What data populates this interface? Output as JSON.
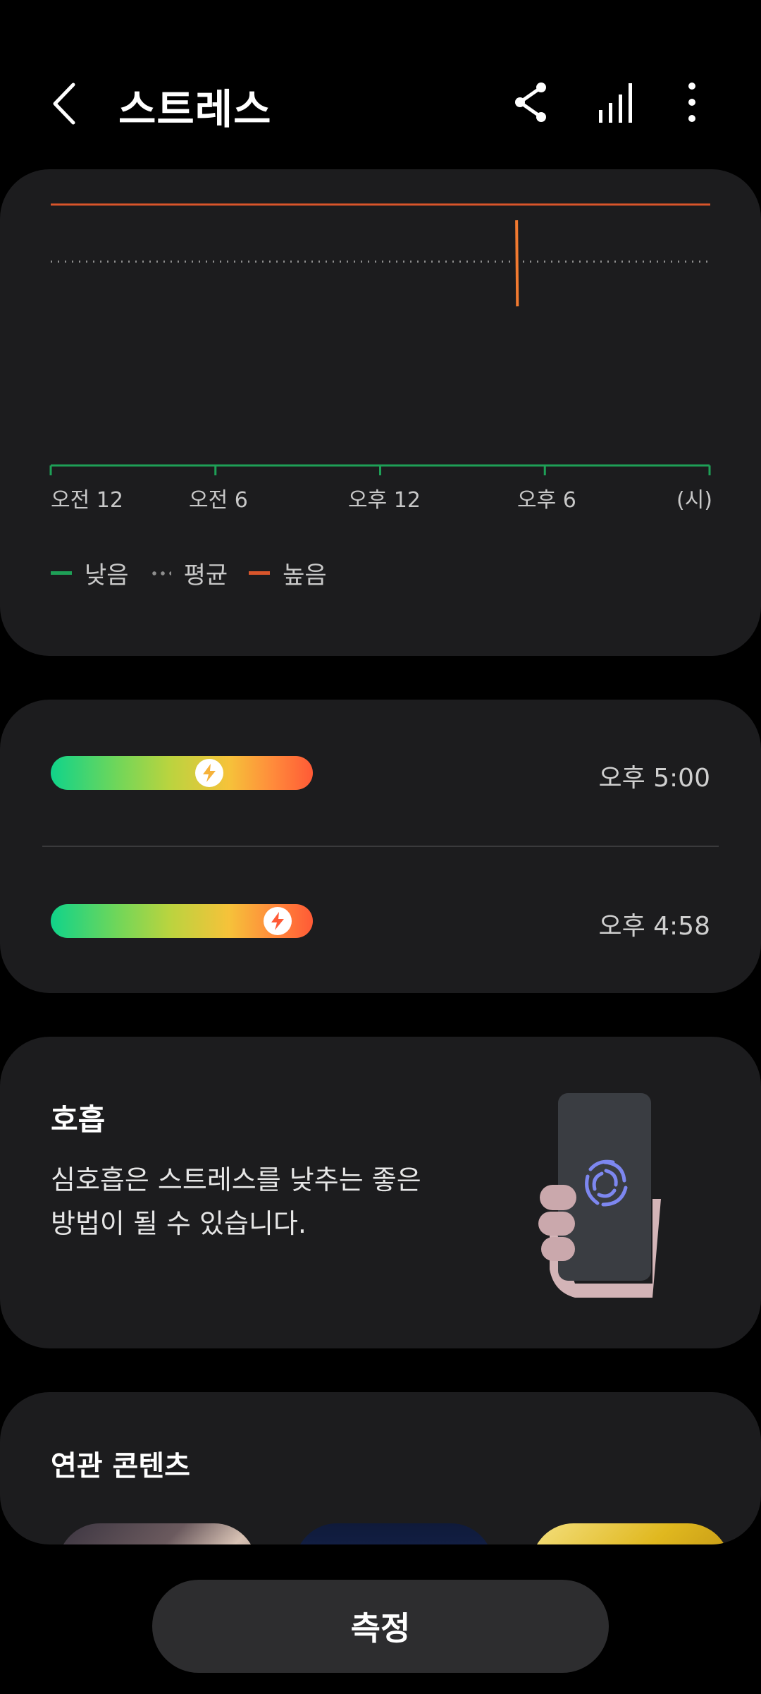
{
  "header": {
    "title": "스트레스",
    "icons": [
      "back-arrow-icon",
      "share-icon",
      "bar-chart-icon",
      "more-vert-icon"
    ]
  },
  "chart": {
    "x_ticks": [
      "오전 12",
      "오전 6",
      "오후 12",
      "오후 6",
      "(시)"
    ],
    "legend": [
      {
        "label": "낮음",
        "color": "#1ea057"
      },
      {
        "label": "평균",
        "color": "#8e8e8e"
      },
      {
        "label": "높음",
        "color": "#d9552b"
      }
    ]
  },
  "chart_data": {
    "type": "line",
    "x_ticks": [
      "오전 12",
      "오전 6",
      "오후 12",
      "오후 6",
      "(시)"
    ],
    "xlim_hours": [
      0,
      24
    ],
    "ylim": [
      0,
      100
    ],
    "reference_lines": [
      {
        "name": "높음",
        "value": 100,
        "color": "#d9552b"
      },
      {
        "name": "평균",
        "value": 79,
        "color": "#8e8e8e"
      }
    ],
    "series": [
      {
        "values": [
          {
            "x": 16.97,
            "y": 94
          },
          {
            "x": 17.0,
            "y": 61
          }
        ]
      }
    ]
  },
  "stress_list": {
    "items": [
      {
        "time": "오후 5:00",
        "level": 0.62
      },
      {
        "time": "오후 4:58",
        "level": 0.92
      }
    ],
    "accent_low": "#10d38a",
    "accent_high": "#ff5a36"
  },
  "breath": {
    "title": "호흡",
    "text": "심호흡은 스트레스를 낮추는 좋은 방법이 될 수 있습니다."
  },
  "related": {
    "title": "연관 콘텐츠"
  },
  "measure_button": {
    "label": "측정"
  }
}
